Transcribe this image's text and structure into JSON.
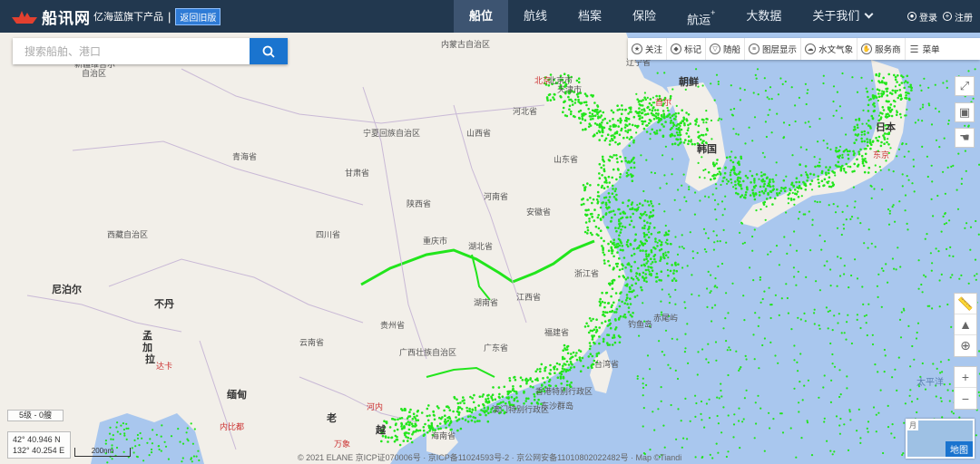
{
  "header": {
    "logo_name": "船讯网",
    "slogan": "亿海蓝旗下产品",
    "separator": "|",
    "old_version": "返回旧版",
    "nav": [
      {
        "label": "船位"
      },
      {
        "label": "航线"
      },
      {
        "label": "档案"
      },
      {
        "label": "保险"
      },
      {
        "label": "航运",
        "sup": "+"
      },
      {
        "label": "大数据"
      },
      {
        "label": "关于我们"
      }
    ],
    "login": "登录",
    "register": "注册"
  },
  "search": {
    "placeholder": "搜索船舶、港口"
  },
  "toolbar": {
    "items": [
      {
        "label": "关注",
        "icon": "star-icon"
      },
      {
        "label": "标记",
        "icon": "tag-icon"
      },
      {
        "label": "随船",
        "icon": "filter-icon"
      },
      {
        "label": "图层显示",
        "icon": "layers-icon"
      },
      {
        "label": "水文气象",
        "icon": "weather-icon"
      },
      {
        "label": "服务商",
        "icon": "hand-icon"
      },
      {
        "label": "菜单",
        "icon": "menu-icon"
      }
    ]
  },
  "map": {
    "zoom_level": "5级 - 0艘",
    "lat": "42° 40.946 N",
    "lon": "132° 40.254 E",
    "scale": "200nm",
    "copyright": "© 2021 ELANE  京ICP证070006号 · 京ICP备11024593号-2 · 京公网安备11010802022482号 · Map ©Tiandi",
    "map_type": "地图",
    "map_type_badge": "月",
    "ship_color": "#22e51c",
    "land_color": "#f2efe9",
    "sea_color": "#a9c7ee",
    "places": [
      {
        "name": "内蒙古自治区",
        "type": "region"
      },
      {
        "name": "新疆维吾尔",
        "type": "region"
      },
      {
        "name": "自治区",
        "type": "region"
      },
      {
        "name": "辽宁省",
        "type": "region"
      },
      {
        "name": "北京",
        "type": "capital"
      },
      {
        "name": "北京市",
        "type": "region"
      },
      {
        "name": "天津市",
        "type": "region"
      },
      {
        "name": "朝鲜",
        "type": "country"
      },
      {
        "name": "首尔",
        "type": "capital"
      },
      {
        "name": "韩国",
        "type": "country"
      },
      {
        "name": "日本",
        "type": "country"
      },
      {
        "name": "东京",
        "type": "capital"
      },
      {
        "name": "河北省",
        "type": "region"
      },
      {
        "name": "宁夏回族自治区",
        "type": "region"
      },
      {
        "name": "山西省",
        "type": "region"
      },
      {
        "name": "青海省",
        "type": "region"
      },
      {
        "name": "甘肃省",
        "type": "region"
      },
      {
        "name": "山东省",
        "type": "region"
      },
      {
        "name": "陕西省",
        "type": "region"
      },
      {
        "name": "河南省",
        "type": "region"
      },
      {
        "name": "安徽省",
        "type": "region"
      },
      {
        "name": "西藏自治区",
        "type": "region"
      },
      {
        "name": "四川省",
        "type": "region"
      },
      {
        "name": "重庆市",
        "type": "region"
      },
      {
        "name": "湖北省",
        "type": "region"
      },
      {
        "name": "浙江省",
        "type": "region"
      },
      {
        "name": "尼泊尔",
        "type": "country"
      },
      {
        "name": "不丹",
        "type": "country"
      },
      {
        "name": "湖南省",
        "type": "region"
      },
      {
        "name": "江西省",
        "type": "region"
      },
      {
        "name": "钓鱼岛",
        "type": "region"
      },
      {
        "name": "赤尾屿",
        "type": "region"
      },
      {
        "name": "孟",
        "type": "country"
      },
      {
        "name": "加",
        "type": "country"
      },
      {
        "name": "拉",
        "type": "country"
      },
      {
        "name": "达卡",
        "type": "capital"
      },
      {
        "name": "贵州省",
        "type": "region"
      },
      {
        "name": "福建省",
        "type": "region"
      },
      {
        "name": "云南省",
        "type": "region"
      },
      {
        "name": "广西壮族自治区",
        "type": "region"
      },
      {
        "name": "广东省",
        "type": "region"
      },
      {
        "name": "台湾省",
        "type": "region"
      },
      {
        "name": "太平洋",
        "type": "sea"
      },
      {
        "name": "缅甸",
        "type": "country"
      },
      {
        "name": "香港特别行政区",
        "type": "region"
      },
      {
        "name": "澳门特别行政区",
        "type": "region"
      },
      {
        "name": "东沙群岛",
        "type": "region"
      },
      {
        "name": "河内",
        "type": "capital"
      },
      {
        "name": "老",
        "type": "country"
      },
      {
        "name": "内比都",
        "type": "capital"
      },
      {
        "name": "越",
        "type": "country"
      },
      {
        "name": "海南省",
        "type": "region"
      },
      {
        "name": "万象",
        "type": "capital"
      }
    ]
  }
}
